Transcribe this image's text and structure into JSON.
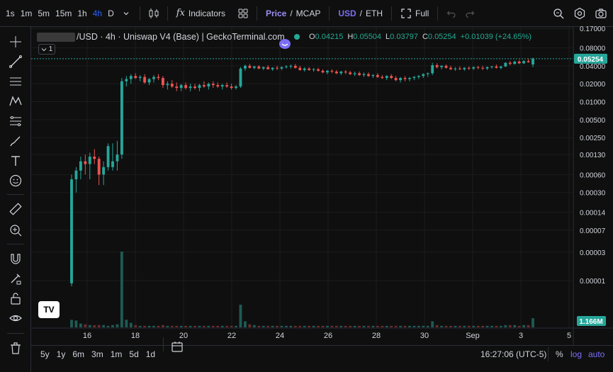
{
  "toolbar": {
    "timeframes": [
      {
        "label": "1s",
        "active": false
      },
      {
        "label": "1m",
        "active": false
      },
      {
        "label": "5m",
        "active": false
      },
      {
        "label": "15m",
        "active": false
      },
      {
        "label": "1h",
        "active": false
      },
      {
        "label": "4h",
        "active": true
      },
      {
        "label": "D",
        "active": false
      }
    ],
    "indicators_label": "Indicators",
    "indicators_icon_text": "fx",
    "price_label": "Price",
    "mcap_label": "MCAP",
    "slash": "/",
    "usd_label": "USD",
    "eth_label": "ETH",
    "full_label": "Full"
  },
  "legend": {
    "title": "/USD · 4h · Uniswap V4 (Base) | GeckoTerminal.com",
    "o_key": "O",
    "o_val": "0.04215",
    "h_key": "H",
    "h_val": "0.05504",
    "l_key": "L",
    "l_val": "0.03797",
    "c_key": "C",
    "c_val": "0.05254",
    "change": "+0.01039 (+24.65%)",
    "collapse_label": "1"
  },
  "price_axis": {
    "ticks": [
      "0.17000",
      "0.08000",
      "0.04000",
      "0.02000",
      "0.01000",
      "0.00500",
      "0.00250",
      "0.00130",
      "0.00060",
      "0.00030",
      "0.00014",
      "0.00007",
      "0.00003",
      "0.00001"
    ],
    "last_price": "0.05254",
    "volume_label": "1.166M"
  },
  "time_axis": {
    "ticks": [
      "16",
      "18",
      "20",
      "22",
      "24",
      "26",
      "28",
      "30",
      "Sep",
      "3",
      "5"
    ]
  },
  "bottom": {
    "ranges": [
      "5y",
      "1y",
      "6m",
      "3m",
      "1m",
      "5d",
      "1d"
    ],
    "time": "16:27:06 (UTC-5)",
    "percent": "%",
    "log": "log",
    "auto": "auto"
  },
  "logo_text": "TV",
  "colors": {
    "up": "#26a69a",
    "down": "#ef5350",
    "accent": "#9b8ef3",
    "label_green": "#22ab94"
  },
  "chart_data": {
    "type": "candlestick",
    "scale": "log",
    "interval": "4h",
    "y_ticks": [
      0.17,
      0.08,
      0.04,
      0.02,
      0.01,
      0.005,
      0.0025,
      0.0013,
      0.0006,
      0.0003,
      0.00014,
      7e-05,
      3e-05,
      1e-05
    ],
    "x_ticks": [
      "16",
      "18",
      "20",
      "22",
      "24",
      "26",
      "28",
      "30",
      "Sep",
      "3",
      "5"
    ],
    "last_close": 0.05254,
    "last_volume": "1.166M",
    "candles": [
      [
        9e-06,
        0.0006,
        8e-06,
        0.0005,
        10
      ],
      [
        0.0005,
        0.0008,
        0.0003,
        0.0007,
        9
      ],
      [
        0.0007,
        0.0012,
        0.0005,
        0.001,
        5
      ],
      [
        0.001,
        0.0013,
        0.0006,
        0.0009,
        4
      ],
      [
        0.0009,
        0.0014,
        0.0005,
        0.0012,
        3
      ],
      [
        0.0012,
        0.0016,
        0.0009,
        0.0011,
        3
      ],
      [
        0.0011,
        0.0012,
        0.0004,
        0.0006,
        3
      ],
      [
        0.0006,
        0.001,
        0.0004,
        0.0008,
        3
      ],
      [
        0.0008,
        0.002,
        0.0007,
        0.0018,
        2
      ],
      [
        0.0008,
        0.002,
        0.0007,
        0.001,
        3
      ],
      [
        0.001,
        0.0022,
        0.0007,
        0.0013,
        4
      ],
      [
        0.0013,
        0.025,
        0.0011,
        0.022,
        100
      ],
      [
        0.022,
        0.027,
        0.018,
        0.024,
        10
      ],
      [
        0.024,
        0.029,
        0.02,
        0.027,
        6
      ],
      [
        0.027,
        0.03,
        0.024,
        0.025,
        3
      ],
      [
        0.025,
        0.028,
        0.022,
        0.026,
        2
      ],
      [
        0.026,
        0.029,
        0.02,
        0.021,
        2
      ],
      [
        0.021,
        0.025,
        0.019,
        0.024,
        2
      ],
      [
        0.024,
        0.028,
        0.021,
        0.026,
        2
      ],
      [
        0.026,
        0.029,
        0.023,
        0.025,
        2
      ],
      [
        0.025,
        0.027,
        0.017,
        0.019,
        3
      ],
      [
        0.019,
        0.022,
        0.016,
        0.02,
        2
      ],
      [
        0.02,
        0.023,
        0.017,
        0.018,
        2
      ],
      [
        0.018,
        0.021,
        0.015,
        0.017,
        2
      ],
      [
        0.017,
        0.02,
        0.015,
        0.019,
        2
      ],
      [
        0.019,
        0.021,
        0.016,
        0.017,
        2
      ],
      [
        0.017,
        0.02,
        0.015,
        0.018,
        2
      ],
      [
        0.018,
        0.02,
        0.016,
        0.017,
        2
      ],
      [
        0.017,
        0.02,
        0.015,
        0.019,
        2
      ],
      [
        0.019,
        0.022,
        0.017,
        0.018,
        2
      ],
      [
        0.018,
        0.021,
        0.016,
        0.02,
        2
      ],
      [
        0.02,
        0.022,
        0.017,
        0.019,
        2
      ],
      [
        0.019,
        0.021,
        0.017,
        0.018,
        2
      ],
      [
        0.018,
        0.02,
        0.016,
        0.019,
        2
      ],
      [
        0.019,
        0.021,
        0.017,
        0.018,
        2
      ],
      [
        0.018,
        0.02,
        0.016,
        0.017,
        2
      ],
      [
        0.017,
        0.019,
        0.016,
        0.018,
        2
      ],
      [
        0.018,
        0.038,
        0.017,
        0.036,
        30
      ],
      [
        0.036,
        0.042,
        0.033,
        0.04,
        8
      ],
      [
        0.04,
        0.043,
        0.036,
        0.037,
        4
      ],
      [
        0.037,
        0.04,
        0.035,
        0.039,
        3
      ],
      [
        0.039,
        0.041,
        0.035,
        0.036,
        2
      ],
      [
        0.036,
        0.039,
        0.034,
        0.038,
        2
      ],
      [
        0.038,
        0.041,
        0.035,
        0.035,
        2
      ],
      [
        0.035,
        0.038,
        0.033,
        0.037,
        2
      ],
      [
        0.037,
        0.04,
        0.034,
        0.036,
        2
      ],
      [
        0.036,
        0.039,
        0.034,
        0.038,
        2
      ],
      [
        0.038,
        0.041,
        0.036,
        0.039,
        2
      ],
      [
        0.039,
        0.042,
        0.036,
        0.04,
        2
      ],
      [
        0.04,
        0.043,
        0.036,
        0.037,
        2
      ],
      [
        0.037,
        0.04,
        0.033,
        0.034,
        2
      ],
      [
        0.034,
        0.038,
        0.032,
        0.036,
        2
      ],
      [
        0.036,
        0.038,
        0.033,
        0.034,
        2
      ],
      [
        0.034,
        0.037,
        0.032,
        0.035,
        2
      ],
      [
        0.035,
        0.037,
        0.032,
        0.033,
        2
      ],
      [
        0.033,
        0.035,
        0.03,
        0.031,
        2
      ],
      [
        0.031,
        0.034,
        0.029,
        0.033,
        2
      ],
      [
        0.033,
        0.035,
        0.03,
        0.032,
        2
      ],
      [
        0.032,
        0.034,
        0.029,
        0.03,
        2
      ],
      [
        0.03,
        0.033,
        0.028,
        0.032,
        2
      ],
      [
        0.032,
        0.034,
        0.029,
        0.031,
        2
      ],
      [
        0.031,
        0.033,
        0.028,
        0.029,
        2
      ],
      [
        0.029,
        0.032,
        0.027,
        0.03,
        2
      ],
      [
        0.03,
        0.032,
        0.027,
        0.028,
        2
      ],
      [
        0.028,
        0.031,
        0.026,
        0.029,
        2
      ],
      [
        0.029,
        0.031,
        0.026,
        0.027,
        2
      ],
      [
        0.027,
        0.029,
        0.025,
        0.028,
        2
      ],
      [
        0.028,
        0.03,
        0.025,
        0.026,
        2
      ],
      [
        0.026,
        0.028,
        0.024,
        0.025,
        2
      ],
      [
        0.025,
        0.028,
        0.023,
        0.027,
        2
      ],
      [
        0.027,
        0.029,
        0.024,
        0.025,
        2
      ],
      [
        0.025,
        0.027,
        0.022,
        0.023,
        2
      ],
      [
        0.023,
        0.026,
        0.021,
        0.025,
        2
      ],
      [
        0.025,
        0.027,
        0.022,
        0.024,
        2
      ],
      [
        0.024,
        0.026,
        0.022,
        0.025,
        2
      ],
      [
        0.025,
        0.027,
        0.023,
        0.026,
        2
      ],
      [
        0.026,
        0.028,
        0.024,
        0.027,
        2
      ],
      [
        0.027,
        0.03,
        0.025,
        0.029,
        2
      ],
      [
        0.029,
        0.031,
        0.026,
        0.03,
        2
      ],
      [
        0.03,
        0.045,
        0.028,
        0.041,
        8
      ],
      [
        0.041,
        0.044,
        0.036,
        0.038,
        3
      ],
      [
        0.038,
        0.041,
        0.035,
        0.04,
        2
      ],
      [
        0.04,
        0.042,
        0.036,
        0.037,
        2
      ],
      [
        0.037,
        0.04,
        0.034,
        0.035,
        2
      ],
      [
        0.035,
        0.038,
        0.033,
        0.036,
        2
      ],
      [
        0.036,
        0.039,
        0.034,
        0.035,
        2
      ],
      [
        0.035,
        0.038,
        0.033,
        0.037,
        2
      ],
      [
        0.037,
        0.039,
        0.034,
        0.036,
        2
      ],
      [
        0.036,
        0.039,
        0.034,
        0.038,
        2
      ],
      [
        0.038,
        0.04,
        0.035,
        0.037,
        2
      ],
      [
        0.037,
        0.04,
        0.034,
        0.036,
        2
      ],
      [
        0.036,
        0.039,
        0.034,
        0.038,
        2
      ],
      [
        0.038,
        0.04,
        0.036,
        0.039,
        2
      ],
      [
        0.039,
        0.042,
        0.036,
        0.037,
        2
      ],
      [
        0.037,
        0.04,
        0.035,
        0.039,
        2
      ],
      [
        0.039,
        0.046,
        0.038,
        0.045,
        3
      ],
      [
        0.045,
        0.048,
        0.041,
        0.043,
        3
      ],
      [
        0.043,
        0.049,
        0.042,
        0.047,
        3
      ],
      [
        0.047,
        0.05,
        0.043,
        0.044,
        2
      ],
      [
        0.044,
        0.05,
        0.043,
        0.048,
        3
      ],
      [
        0.048,
        0.053,
        0.045,
        0.046,
        3
      ],
      [
        0.04215,
        0.05504,
        0.03797,
        0.05254,
        12
      ]
    ]
  }
}
